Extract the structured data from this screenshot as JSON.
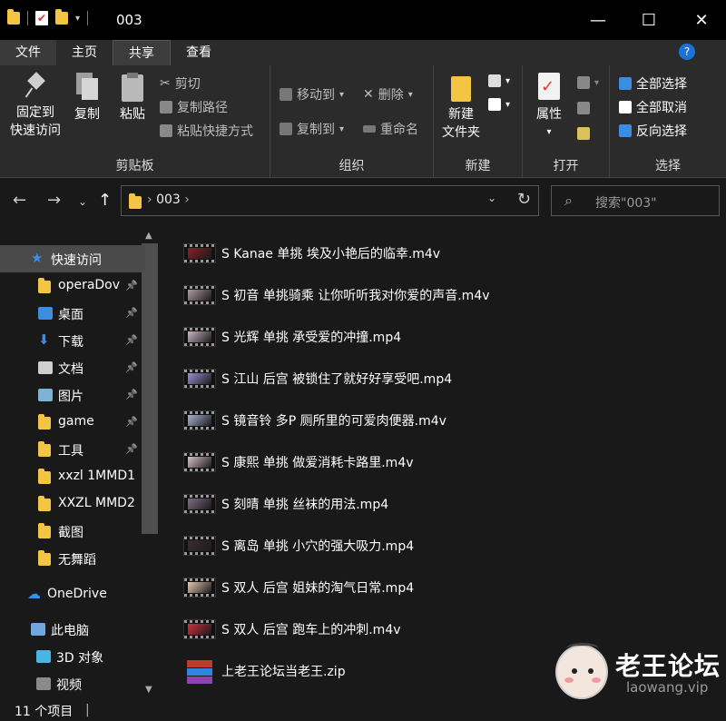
{
  "window": {
    "title": "003",
    "minimize": "—",
    "maximize": "☐",
    "close": "✕"
  },
  "ribbon_tabs": [
    {
      "label": "文件"
    },
    {
      "label": "主页"
    },
    {
      "label": "共享"
    },
    {
      "label": "查看"
    }
  ],
  "ribbon": {
    "clipboard": {
      "label": "剪贴板",
      "pin_line1": "固定到",
      "pin_line2": "快速访问",
      "copy": "复制",
      "paste": "粘贴",
      "cut": "剪切",
      "copy_path": "复制路径",
      "paste_shortcut": "粘贴快捷方式"
    },
    "organize": {
      "label": "组织",
      "move_to": "移动到",
      "copy_to": "复制到",
      "delete": "删除",
      "rename": "重命名"
    },
    "new": {
      "label": "新建",
      "new_folder_line1": "新建",
      "new_folder_line2": "文件夹"
    },
    "open": {
      "label": "打开",
      "properties": "属性"
    },
    "select": {
      "label": "选择",
      "select_all": "全部选择",
      "select_none": "全部取消",
      "invert": "反向选择"
    }
  },
  "address": {
    "crumb": "003",
    "search_placeholder": "搜索\"003\""
  },
  "nav_pane": {
    "items": [
      {
        "label": "快速访问",
        "icon": "star-icon",
        "pinned": false
      },
      {
        "label": "operaDov",
        "icon": "folder-icon",
        "pinned": true
      },
      {
        "label": "桌面",
        "icon": "desktop-icon",
        "pinned": true
      },
      {
        "label": "下载",
        "icon": "download-icon",
        "pinned": true
      },
      {
        "label": "文档",
        "icon": "document-icon",
        "pinned": true
      },
      {
        "label": "图片",
        "icon": "pictures-icon",
        "pinned": true
      },
      {
        "label": "game",
        "icon": "folder-icon",
        "pinned": true
      },
      {
        "label": "工具",
        "icon": "folder-icon",
        "pinned": true
      },
      {
        "label": "xxzl 1MMD1",
        "icon": "folder-icon",
        "pinned": false
      },
      {
        "label": "XXZL MMD2",
        "icon": "folder-icon",
        "pinned": false
      },
      {
        "label": "截图",
        "icon": "folder-icon",
        "pinned": false
      },
      {
        "label": "无舞蹈",
        "icon": "folder-icon",
        "pinned": false
      },
      {
        "label": "OneDrive",
        "icon": "cloud-icon",
        "pinned": false
      },
      {
        "label": "此电脑",
        "icon": "computer-icon",
        "pinned": false
      },
      {
        "label": "3D 对象",
        "icon": "cube-icon",
        "pinned": false
      },
      {
        "label": "视频",
        "icon": "video-icon",
        "pinned": false
      }
    ]
  },
  "files": [
    {
      "name": "S Kanae 单挑 埃及小艳后的临幸.m4v",
      "thumb_color": "#8a1f2a"
    },
    {
      "name": "S 初音 单挑骑乘 让你听听我对你爱的声音.m4v",
      "thumb_color": "#b09aa3"
    },
    {
      "name": "S 光辉 单挑 承受爱的冲撞.mp4",
      "thumb_color": "#c9b6c2"
    },
    {
      "name": "S 江山 后宫 被锁住了就好好享受吧.mp4",
      "thumb_color": "#9a8fd0"
    },
    {
      "name": "S 镜音铃 多P 厕所里的可爱肉便器.m4v",
      "thumb_color": "#a7b5d4"
    },
    {
      "name": "S 康熙 单挑 做爱消耗卡路里.m4v",
      "thumb_color": "#d8c2cc"
    },
    {
      "name": "S 刻晴 单挑 丝袜的用法.mp4",
      "thumb_color": "#7e6e86"
    },
    {
      "name": "S 离岛 单挑 小穴的强大吸力.mp4",
      "thumb_color": "#3a2e34"
    },
    {
      "name": "S 双人 后宫 姐妹的淘气日常.mp4",
      "thumb_color": "#e8c9b2"
    },
    {
      "name": "S 双人 后宫 跑车上的冲刺.m4v",
      "thumb_color": "#d02e3c"
    },
    {
      "name": "上老王论坛当老王.zip",
      "thumb_color": "#7b3fa0"
    }
  ],
  "status": {
    "count": "11 个项目",
    "separator": "|"
  },
  "watermark": {
    "title": "老王论坛",
    "url": "laowang.vip"
  }
}
